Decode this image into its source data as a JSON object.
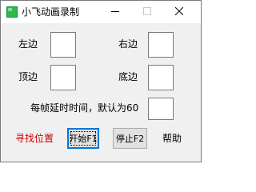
{
  "window": {
    "title": "小飞动画录制",
    "icon": "green-square-app-icon",
    "controls": {
      "minimize_icon": "minimize-icon",
      "maximize_icon": "maximize-icon",
      "close_icon": "close-icon"
    }
  },
  "form": {
    "left_label": "左边",
    "left_value": "",
    "right_label": "右边",
    "right_value": "",
    "top_label": "顶边",
    "top_value": "",
    "bottom_label": "底边",
    "bottom_value": "",
    "delay_label": "每帧延时时间，默认为60",
    "delay_value": ""
  },
  "actions": {
    "find_position": "寻找位置",
    "start_label": "开始F1",
    "stop_label": "停止F2",
    "help_label": "帮助"
  },
  "colors": {
    "client_bg": "#f0f0f0",
    "link_red": "#cc0000",
    "app_icon_green": "#2db84d",
    "focus_blue": "#0078d7"
  }
}
